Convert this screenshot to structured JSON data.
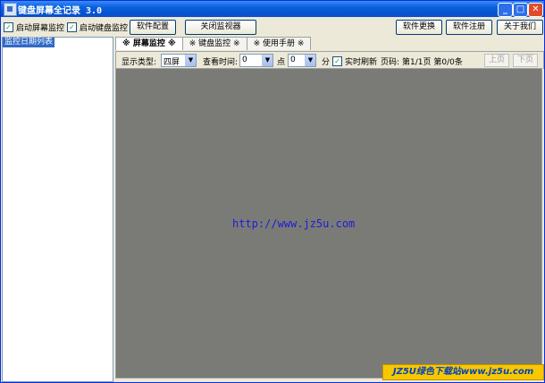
{
  "window": {
    "title": "键盘屏幕全记录 3.0",
    "min_label": "_",
    "max_label": "□",
    "close_label": "✕"
  },
  "toolbar": {
    "screen_monitor_label": "启动屏幕监控",
    "keyboard_monitor_label": "启动键盘监控",
    "check_mark": "✓",
    "config_label": "软件配置",
    "close_monitor_label": "关闭监视器",
    "update_label": "软件更换",
    "register_label": "软件注册",
    "about_label": "关于我们"
  },
  "sidebar": {
    "header": "监控日期列表"
  },
  "tabs": [
    {
      "label": "※ 屏幕监控 ※"
    },
    {
      "label": "※ 键盘监控 ※"
    },
    {
      "label": "※ 使用手册 ※"
    }
  ],
  "options": {
    "display_type_label": "显示类型:",
    "display_type_value": "四屏",
    "view_time_label": "查看时间:",
    "hour_value": "0",
    "hour_unit": "点",
    "minute_value": "0",
    "minute_unit": "分",
    "realtime_label": "实时刷新",
    "page_label": "页码:",
    "page_info": "第1/1页 第0/0条",
    "prev_label": "上页",
    "next_label": "下页"
  },
  "content": {
    "url_text": "http://www.jz5u.com"
  },
  "watermark": {
    "text": "JZ5U绿色下载站www.jz5u.com"
  },
  "colors": {
    "titlebar": "#0a5fde",
    "content_bg": "#7a7b77",
    "url": "#1c1cd8",
    "watermark_bg": "#f6c800"
  }
}
